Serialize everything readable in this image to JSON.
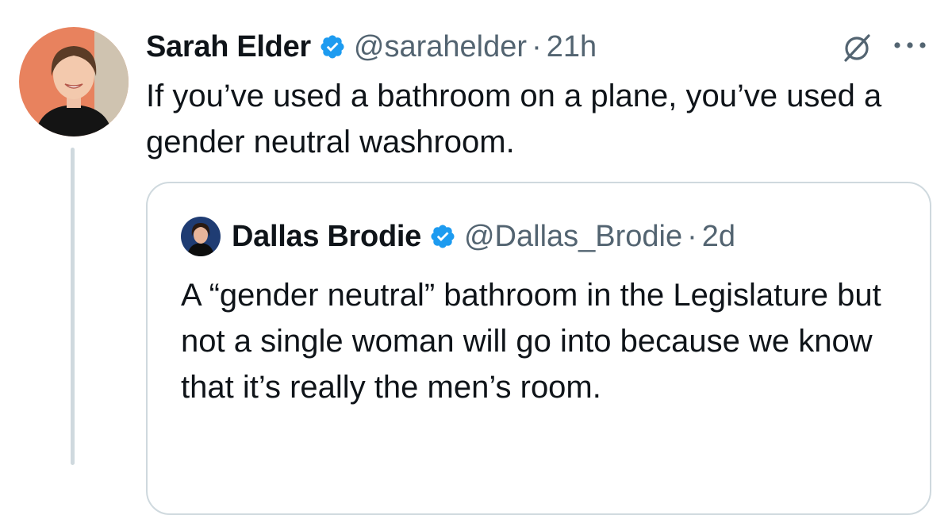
{
  "tweet": {
    "author_name": "Sarah Elder",
    "handle": "@sarahelder",
    "separator": "·",
    "time": "21h",
    "text": "If you’ve used a bathroom on a plane, you’ve used a gender neutral washroom.",
    "verified_icon": "verified-badge-icon",
    "action_icons": [
      "grok-icon",
      "more-options-icon"
    ]
  },
  "quote": {
    "author_name": "Dallas Brodie",
    "handle": "@Dallas_Brodie",
    "separator": "·",
    "time": "2d",
    "text": "A “gender neutral” bathroom in the Legislature but not a single woman will go into because we know that it’s really the men’s room."
  },
  "colors": {
    "verified": "#1d9bf0",
    "secondary_text": "#536471",
    "border": "#cfd9de"
  }
}
